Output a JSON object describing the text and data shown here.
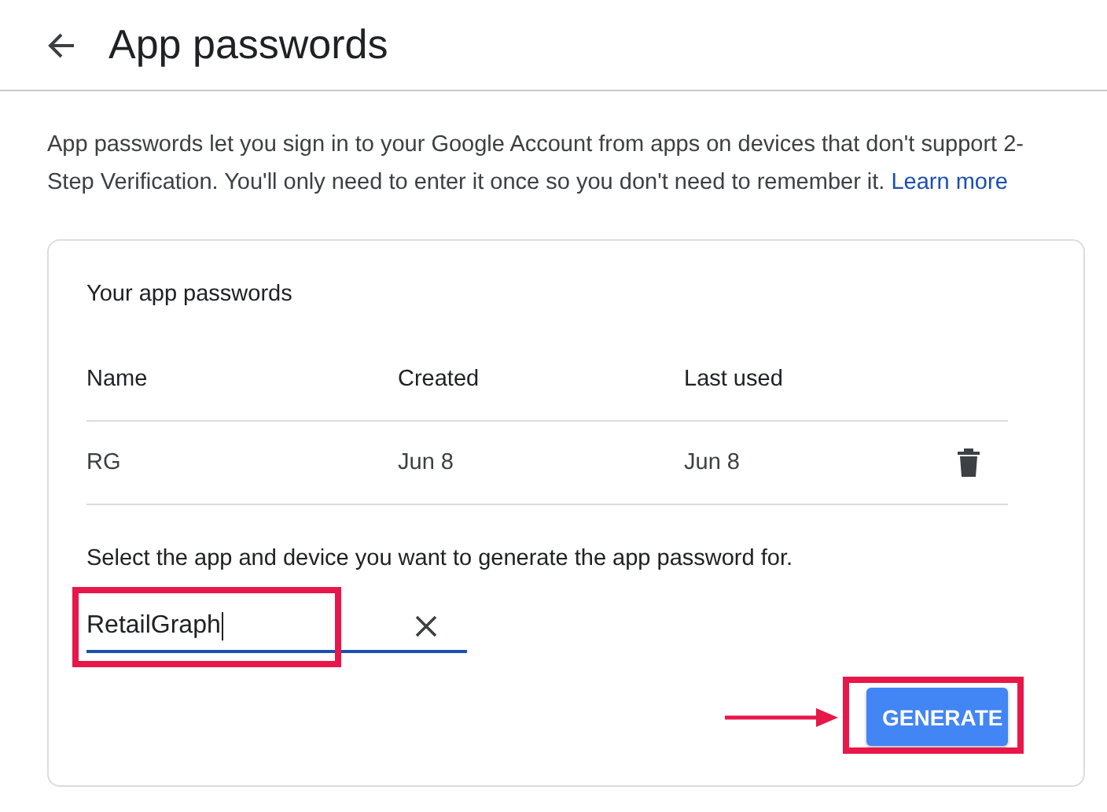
{
  "header": {
    "title": "App passwords"
  },
  "description": {
    "text": "App passwords let you sign in to your Google Account from apps on devices that don't support 2-Step Verification. You'll only need to enter it once so you don't need to remember it.",
    "link": "Learn more"
  },
  "card": {
    "title": "Your app passwords",
    "columns": [
      "Name",
      "Created",
      "Last used"
    ],
    "rows": [
      {
        "cells": [
          "RG",
          "Jun 8",
          "Jun 8"
        ]
      }
    ],
    "prompt": "Select the app and device you want to generate the app password for.",
    "field": {
      "value": "RetailGraph",
      "highlighted": true
    },
    "button": {
      "label": "GENERATE",
      "highlighted": true,
      "pointer_arrow": true
    }
  }
}
